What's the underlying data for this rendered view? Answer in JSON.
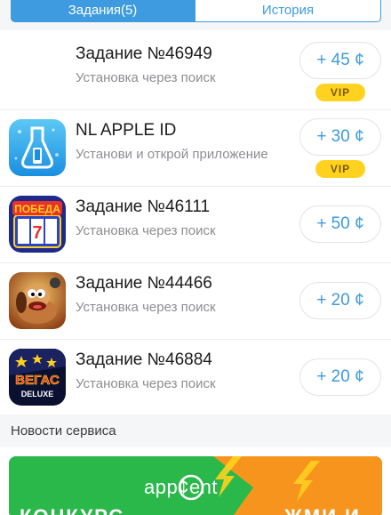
{
  "tabs": {
    "active_label": "Задания(5)",
    "inactive_label": "История"
  },
  "tasks": [
    {
      "title": "Задание №46949",
      "subtitle": "Установка через поиск",
      "reward": "+ 45 ¢",
      "badge": "VIP",
      "icon": "none"
    },
    {
      "title": "NL APPLE ID",
      "subtitle": "Установи и открой приложение",
      "reward": "+ 30 ¢",
      "badge": "VIP",
      "icon": "apple-id-app-icon"
    },
    {
      "title": "Задание №46111",
      "subtitle": "Установка через поиск",
      "reward": "+ 50 ¢",
      "badge": "",
      "icon": "pobeda-slot-app-icon"
    },
    {
      "title": "Задание №44466",
      "subtitle": "Установка через поиск",
      "reward": "+ 20 ¢",
      "badge": "",
      "icon": "cartoon-dog-app-icon"
    },
    {
      "title": "Задание №46884",
      "subtitle": "Установка через поиск",
      "reward": "+ 20 ¢",
      "badge": "",
      "icon": "vegas-deluxe-app-icon"
    }
  ],
  "icon_text": {
    "pobeda": "ПОБЕДА",
    "seven": "7",
    "vegas": "ВЕГАС",
    "deluxe": "DELUXE"
  },
  "news": {
    "header": "Новости сервиса",
    "banner_brand": "app¢ent",
    "banner_left": "КОНКУРС",
    "banner_right": "ЖМИ И"
  },
  "colors": {
    "accent": "#3e9be0",
    "vip": "#ffd21f",
    "banner_green": "#2ab84a",
    "banner_orange": "#f7941d"
  }
}
